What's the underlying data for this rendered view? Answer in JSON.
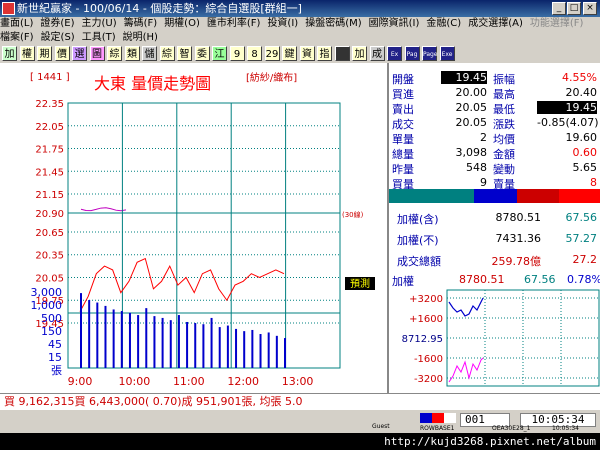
{
  "app": {
    "title": "新世紀贏家 - 100/06/14 - 個股走勢：綜合自選股[群組一]"
  },
  "window_buttons": [
    "_",
    "□",
    "×"
  ],
  "menu1": [
    "畫面(L)",
    "證券(E)",
    "主力(U)",
    "籌碼(F)",
    "期權(O)",
    "匯市利率(F)",
    "投資(I)",
    "操盤密碼(M)",
    "國際資訊(I)",
    "金融(C)",
    "成交選擇(A)"
  ],
  "menu1_disabled": "功能選擇(F)",
  "menu2": [
    "檔案(F)",
    "設定(S)",
    "工具(T)",
    "說明(H)"
  ],
  "toolbar": [
    "加",
    "權",
    "期",
    "價",
    "選",
    "圖",
    "綜",
    "類",
    "儲",
    "綜",
    "智",
    "委",
    "江",
    "9",
    "8",
    "29",
    "鍵",
    "資",
    "指",
    "",
    "加",
    "成",
    "Ex",
    "Pag",
    "Page",
    "Exe"
  ],
  "chart": {
    "stock_code": "[ 1441 ]",
    "title": "大東  量價走勢圖",
    "category": "[紡紗/織布]",
    "ref_price_label": "(30線)",
    "y_labels_red": [
      "22.35",
      "22.05",
      "21.75",
      "21.45",
      "21.15",
      "20.90",
      "20.65",
      "20.35",
      "20.05",
      "19.75",
      "19.45"
    ],
    "vol_labels": [
      "3,000",
      "1,000",
      "500",
      "150",
      "45",
      "15",
      "張"
    ],
    "x_labels": [
      "9:00",
      "10:00",
      "11:00",
      "12:00",
      "13:00"
    ],
    "forecast_badge": "預測",
    "colors": {
      "grid": "#008080",
      "price": "#ff0000",
      "ref": "#c000c0",
      "volume": "#0000cc"
    }
  },
  "chart_data": {
    "type": "line",
    "x": [
      "9:00",
      "9:03",
      "9:06",
      "9:09",
      "9:12",
      "9:15",
      "9:18",
      "9:21",
      "9:24",
      "9:27",
      "9:30",
      "9:33",
      "9:36",
      "9:39",
      "9:42",
      "9:45",
      "9:48",
      "9:51",
      "9:54",
      "9:57",
      "10:00",
      "10:03",
      "10:06",
      "10:09",
      "10:12",
      "10:15"
    ],
    "series": [
      {
        "values": [
          19.6,
          19.8,
          20.1,
          20.2,
          20.15,
          19.85,
          20.0,
          20.25,
          20.3,
          19.9,
          20.0,
          20.2,
          19.95,
          20.05,
          19.85,
          20.1,
          20.15,
          19.9,
          19.75,
          19.95,
          20.0,
          20.1,
          20.05,
          20.1,
          20.15,
          20.1
        ]
      }
    ],
    "volume": [
      1800,
      900,
      700,
      500,
      350,
      300,
      250,
      200,
      400,
      180,
      150,
      120,
      200,
      100,
      90,
      80,
      150,
      60,
      70,
      50,
      40,
      45,
      30,
      35,
      25,
      20
    ],
    "ylim": [
      19.45,
      22.35
    ],
    "ref_price": 20.9
  },
  "quote": [
    {
      "l1": "開盤",
      "v1": "19.45",
      "l2": "振幅",
      "v2": "4.55%"
    },
    {
      "l1": "買進",
      "v1": "20.00",
      "l2": "最高",
      "v2": "20.40"
    },
    {
      "l1": "賣出",
      "v1": "20.05",
      "l2": "最低",
      "v2": "19.45"
    },
    {
      "l1": "成交",
      "v1": "20.05",
      "l2": "漲跌",
      "v2": "-0.85(4.07)"
    },
    {
      "l1": "單量",
      "v1": "2",
      "l2": "均價",
      "v2": "19.60"
    },
    {
      "l1": "總量",
      "v1": "3,098",
      "l2": "金額",
      "v2": "0.60"
    },
    {
      "l1": "昨量",
      "v1": "548",
      "l2": "變動",
      "v2": "5.65"
    },
    {
      "l1": "買量",
      "v1": "9",
      "l2": "賣量",
      "v2": "8"
    }
  ],
  "index": [
    {
      "label": "加權(含)",
      "value": "8780.51",
      "pct": "67.56"
    },
    {
      "label": "加權(不)",
      "value": "7431.36",
      "pct": "57.27"
    },
    {
      "label": "成交總額",
      "value": "259.78億",
      "pct": "27.2"
    }
  ],
  "mini": {
    "label": "加權",
    "value": "8780.51",
    "change": "67.56",
    "pct": "0.78%",
    "y_labels": [
      "+3200",
      "+1600",
      "8712.95",
      "-1600",
      "-3200"
    ]
  },
  "status": "買 9,162,315買 6,443,000( 0.70)成 951,901張, 均張 5.0",
  "bottom": {
    "box": "001",
    "time": "10:05:34",
    "labels": [
      "Guest",
      "ROWBASE1",
      "OEA30E28_1",
      "10:05:34"
    ]
  },
  "footer": "http://kujd3268.pixnet.net/album"
}
